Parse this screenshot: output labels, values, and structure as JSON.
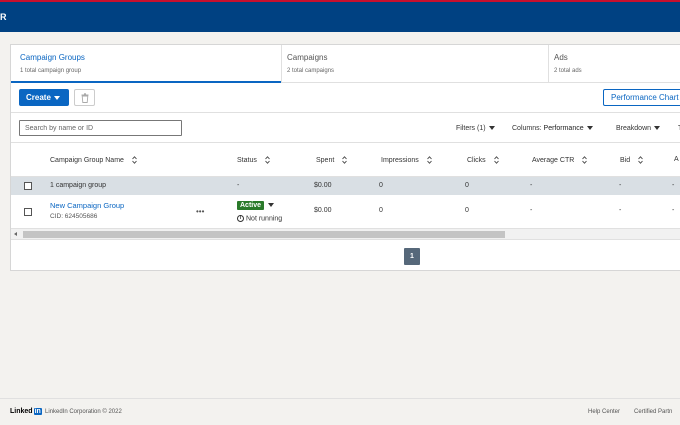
{
  "app": {
    "header_letter": "R"
  },
  "tabs": [
    {
      "name": "Campaign Groups",
      "count": "1 total campaign group"
    },
    {
      "name": "Campaigns",
      "count": "2 total campaigns"
    },
    {
      "name": "Ads",
      "count": "2 total ads"
    }
  ],
  "toolbar": {
    "create_label": "Create",
    "performance_label": "Performance Chart"
  },
  "filters": {
    "search_placeholder": "Search by name or ID",
    "filters_label": "Filters (1)",
    "columns_label": "Columns:",
    "columns_value": "Performance",
    "breakdown_label": "Breakdown",
    "extra_label": "T"
  },
  "table": {
    "headers": [
      "Campaign Group Name",
      "Status",
      "Spent",
      "Impressions",
      "Clicks",
      "Average CTR",
      "Bid",
      "A"
    ],
    "summary": {
      "name": "1 campaign group",
      "status": "-",
      "spent": "$0.00",
      "impressions": "0",
      "clicks": "0",
      "ctr": "-",
      "bid": "-",
      "extra": "-"
    },
    "rows": [
      {
        "name": "New Campaign Group",
        "cid": "CID: 624505686",
        "more": "•••",
        "status_badge": "Active",
        "status_note": "Not running",
        "spent": "$0.00",
        "impressions": "0",
        "clicks": "0",
        "ctr": "-",
        "bid": "-",
        "extra": "-"
      }
    ]
  },
  "pagination": {
    "current_page": "1"
  },
  "footer": {
    "logo_text": "Linked",
    "logo_in": "in",
    "corp": "LinkedIn Corporation © 2022",
    "help": "Help Center",
    "certified": "Certified Partn"
  },
  "colors": {
    "brand_blue": "#0a66c2",
    "header_blue": "#004182",
    "active_green": "#2a7a2a"
  }
}
